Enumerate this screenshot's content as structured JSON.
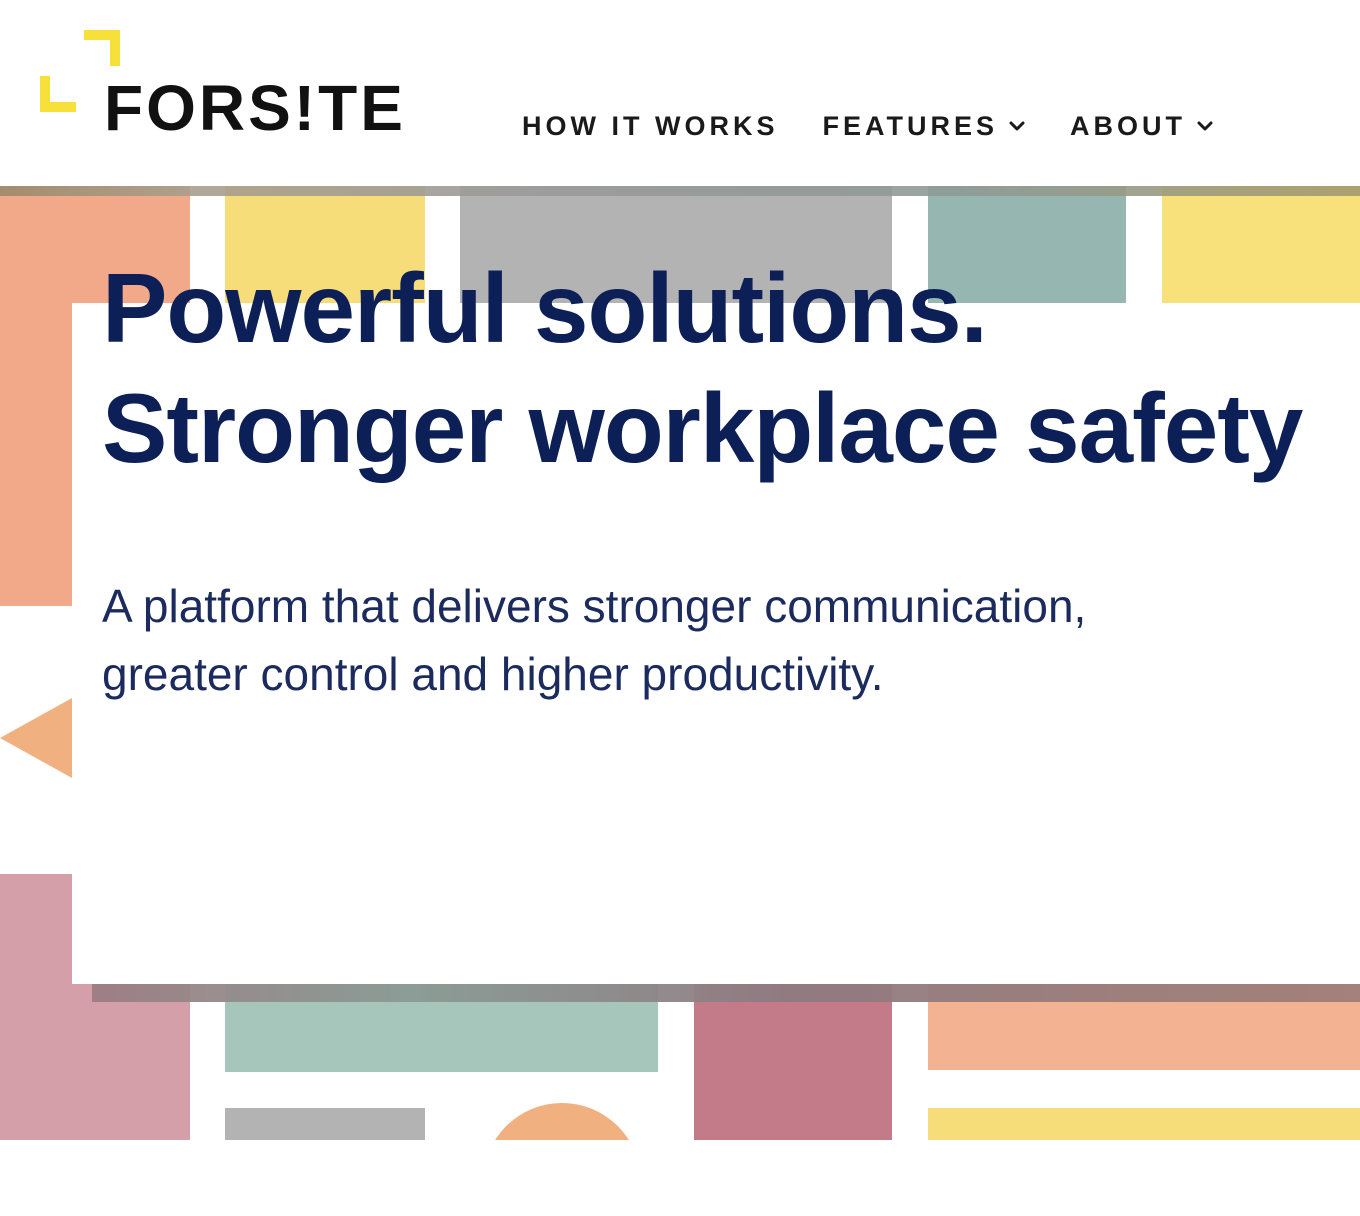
{
  "brand": {
    "name": "FORS!TE",
    "accent_color": "#f7e03a",
    "text_color": "#111111"
  },
  "nav": {
    "items": [
      {
        "label": "HOW IT WORKS",
        "has_dropdown": false
      },
      {
        "label": "FEATURES",
        "has_dropdown": true,
        "icon": "chevron-down-icon"
      },
      {
        "label": "ABOUT",
        "has_dropdown": true,
        "icon": "chevron-down-icon"
      }
    ]
  },
  "hero": {
    "headline_line1": "Powerful solutions.",
    "headline_line2": "Stronger workplace safety",
    "subtext_line1": "A platform that delivers stronger communication,",
    "subtext_line2": "greater control and higher productivity.",
    "headline_color": "#0c1f57",
    "palette": {
      "peach": "#f2a98a",
      "yellow": "#f7dc7a",
      "gray": "#b3b3b3",
      "teal": "#96b6b2",
      "mint": "#a6c6bb",
      "pink": "#d49fa9",
      "rose": "#c37a89",
      "orange": "#f1b07f"
    }
  }
}
